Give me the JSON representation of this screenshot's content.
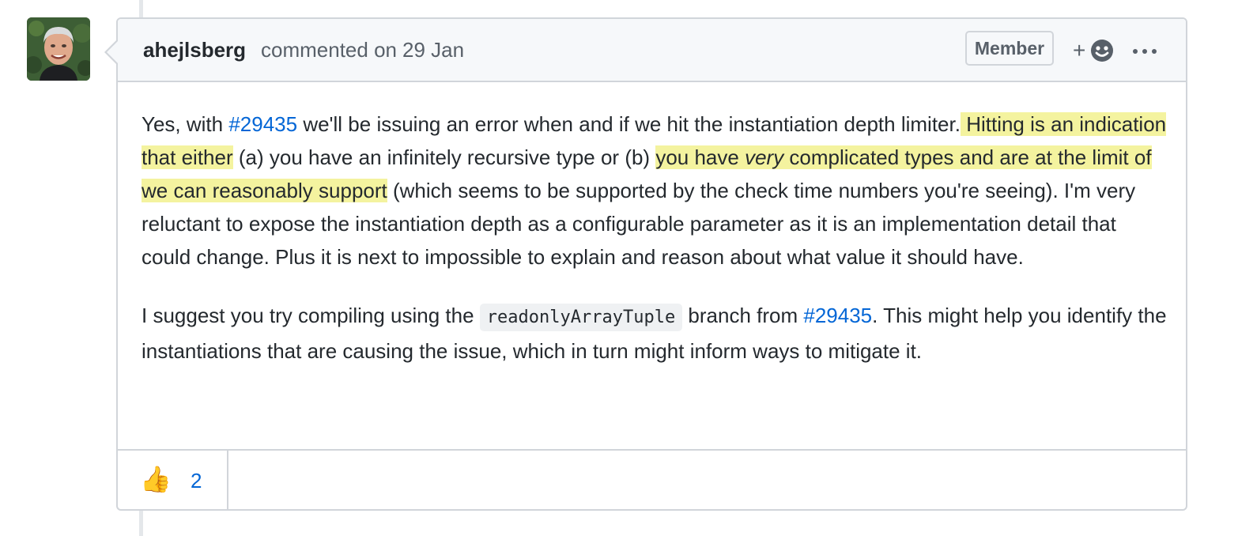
{
  "comment": {
    "author": "ahejlsberg",
    "action": "commented on",
    "date": "29 Jan",
    "badge": "Member",
    "add_reaction_plus": "+",
    "avatar_icon": "user-avatar-photo",
    "paragraph1": {
      "s1": "Yes, with ",
      "link1": "#29435",
      "s2": " we'll be issuing an error when and if we hit the instantiation depth limiter.",
      "h1": " Hitting is an indication that either",
      "s3": " (a) you have an infinitely recursive type or (b) ",
      "h2a": "you have ",
      "h2em": "very",
      "h2b": " complicated types and are at the limit of we can reasonably support",
      "s4": " (which seems to be supported by the check time numbers you're seeing). I'm very reluctant to expose the instantiation depth as a configurable parameter as it is an implementation detail that could change. Plus it is next to impossible to explain and reason about what value it should have."
    },
    "paragraph2": {
      "s1": "I suggest you try compiling using the ",
      "code": "readonlyArrayTuple",
      "s2": " branch from ",
      "link": "#29435",
      "s3": ". This might help you identify the instantiations that are causing the issue, which in turn might inform ways to mitigate it."
    },
    "reactions": [
      {
        "emoji": "👍",
        "icon": "thumbs-up-icon",
        "count": "2"
      }
    ]
  },
  "colors": {
    "link": "#0366d6",
    "highlight": "#f4f39f",
    "header_bg": "#f6f8fa",
    "border": "#d1d5da",
    "muted_text": "#586069"
  }
}
